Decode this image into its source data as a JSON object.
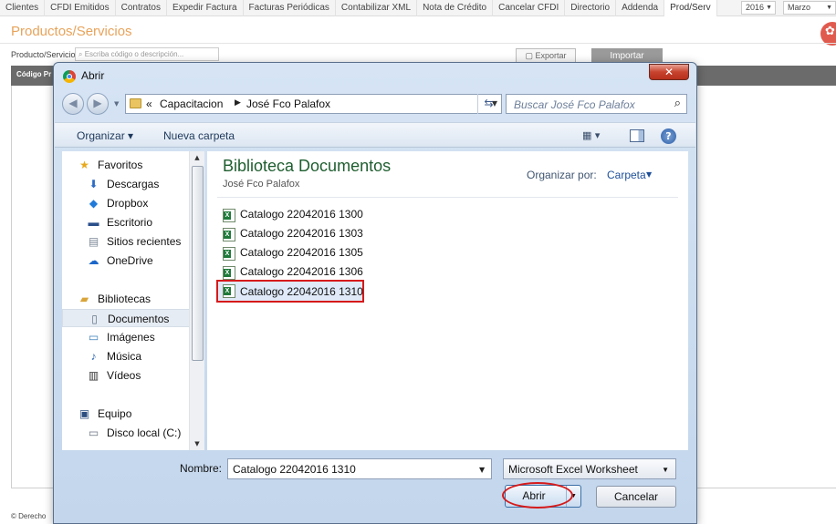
{
  "app": {
    "nav_tabs": [
      "Clientes",
      "CFDI Emitidos",
      "Contratos",
      "Expedir Factura",
      "Facturas Periódicas",
      "Contabilizar XML",
      "Nota de Crédito",
      "Cancelar CFDI",
      "Directorio",
      "Addenda",
      "Prod/Serv"
    ],
    "active_tab": "Prod/Serv",
    "year_select": "2016",
    "month_select": "Marzo",
    "page_title": "Productos/Servicios",
    "filter_label": "Producto/Servicio",
    "filter_placeholder": "Escriba código o descripción...",
    "export_label": "Exportar",
    "import_label": "Importar",
    "grid_header_partial": "Código Pr",
    "footer_partial": "© Derecho"
  },
  "dialog": {
    "title": "Abrir",
    "close_label": "✕",
    "breadcrumb": [
      "Capacitacion",
      "José Fco Palafox"
    ],
    "breadcrumb_prefix": "«",
    "search_placeholder": "Buscar José Fco Palafox",
    "toolbar": {
      "organize_label": "Organizar ▾",
      "new_folder_label": "Nueva carpeta",
      "help_label": "?"
    },
    "nav": {
      "favorites": {
        "label": "Favoritos",
        "items": [
          "Descargas",
          "Dropbox",
          "Escritorio",
          "Sitios recientes",
          "OneDrive"
        ]
      },
      "libraries": {
        "label": "Bibliotecas",
        "items": [
          "Documentos",
          "Imágenes",
          "Música",
          "Vídeos"
        ]
      },
      "computer": {
        "label": "Equipo",
        "items": [
          "Disco local (C:)"
        ]
      }
    },
    "selected_nav_item": "Documentos",
    "library_title": "Biblioteca Documentos",
    "library_subtitle": "José Fco Palafox",
    "arrange_label": "Organizar por:",
    "arrange_value": "Carpeta",
    "files": [
      "Catalogo 22042016 1300",
      "Catalogo 22042016 1303",
      "Catalogo 22042016 1305",
      "Catalogo 22042016 1306",
      "Catalogo 22042016 1310"
    ],
    "selected_file": "Catalogo 22042016 1310",
    "filename_label": "Nombre:",
    "filename_value": "Catalogo 22042016 1310",
    "filetype_value": "Microsoft Excel Worksheet",
    "open_label": "Abrir",
    "cancel_label": "Cancelar"
  },
  "colors": {
    "title_orange": "#e8a35a",
    "library_green": "#1e5e2f",
    "highlight_red": "#d51a1a",
    "close_red": "#c7432e"
  }
}
